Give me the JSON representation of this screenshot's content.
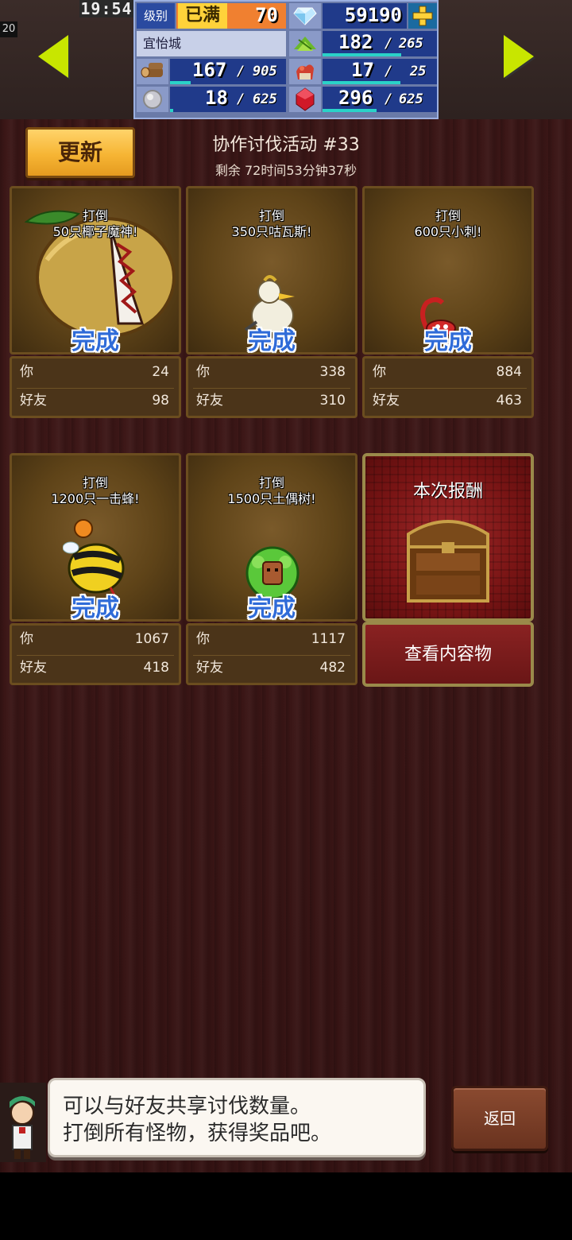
{
  "status": {
    "clock": "19:54",
    "fps": "20",
    "level_label": "级别",
    "level_max": "已满",
    "level_value": "70",
    "gems": "59190",
    "town_name": "宜怡城",
    "grass_current": "182",
    "grass_max": "265",
    "wood_current": "167",
    "wood_max": "905",
    "food_current": "17",
    "food_max": "25",
    "ore_current": "18",
    "ore_max": "625",
    "ruby_current": "296",
    "ruby_max": "625",
    "separator": "/",
    "bar_fill": {
      "grass": 0.69,
      "wood": 0.18,
      "food": 0.68,
      "ore": 0.03,
      "ruby": 0.47
    }
  },
  "event": {
    "refresh_label": "更新",
    "title": "协作讨伐活动 #33",
    "time_left": "剩余 72时间53分钟37秒"
  },
  "cards": [
    {
      "objective_line1": "打倒",
      "objective_line2": "50只椰子魔神!",
      "status": "完成",
      "you_label": "你",
      "you_value": "24",
      "friend_label": "好友",
      "friend_value": "98",
      "monster": "coconut-demon"
    },
    {
      "objective_line1": "打倒",
      "objective_line2": "350只咕瓦斯!",
      "status": "完成",
      "you_label": "你",
      "you_value": "338",
      "friend_label": "好友",
      "friend_value": "310",
      "monster": "white-bird"
    },
    {
      "objective_line1": "打倒",
      "objective_line2": "600只小刺!",
      "status": "完成",
      "you_label": "你",
      "you_value": "884",
      "friend_label": "好友",
      "friend_value": "463",
      "monster": "red-scorpion"
    },
    {
      "objective_line1": "打倒",
      "objective_line2": "1200只一击蜂!",
      "status": "完成",
      "you_label": "你",
      "you_value": "1067",
      "friend_label": "好友",
      "friend_value": "418",
      "monster": "bee"
    },
    {
      "objective_line1": "打倒",
      "objective_line2": "1500只土偶树!",
      "status": "完成",
      "you_label": "你",
      "you_value": "1117",
      "friend_label": "好友",
      "friend_value": "482",
      "monster": "tree-doll"
    }
  ],
  "reward": {
    "title": "本次报酬",
    "view_button": "查看内容物"
  },
  "dialog": {
    "line1": "可以与好友共享讨伐数量。",
    "line2": "打倒所有怪物，获得奖品吧。"
  },
  "back_button": "返回",
  "colors": {
    "accent_yellow": "#f6b534",
    "done_blue": "#2f6bd8",
    "panel_blue": "#203a8a",
    "bar_teal": "#2ad2c8",
    "reward_red": "#7a1515"
  }
}
